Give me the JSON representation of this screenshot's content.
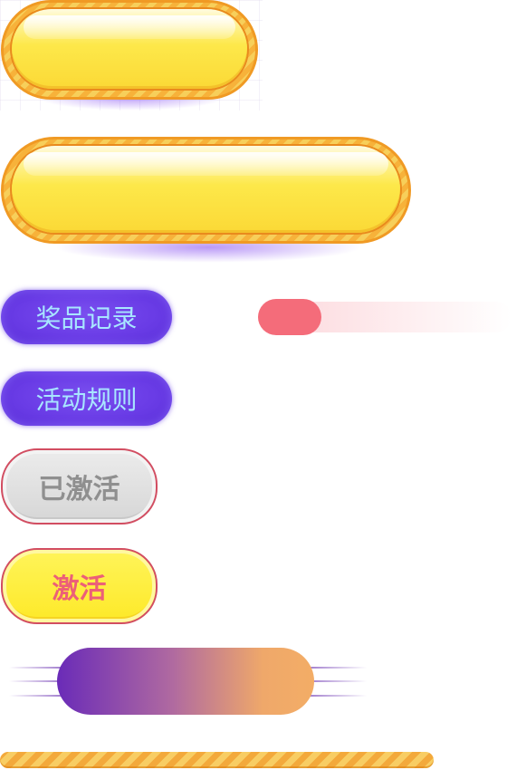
{
  "buttons": {
    "prize_record": "奖品记录",
    "activity_rules": "活动规则",
    "activated": "已激活",
    "activate": "激活"
  },
  "progress": {
    "value": 0.25
  },
  "colors": {
    "purple": "#6a3ce6",
    "yellow": "#fde84a",
    "orange_border": "#f09a24",
    "pink": "#f46c7a",
    "gray": "#d6d6d6"
  }
}
